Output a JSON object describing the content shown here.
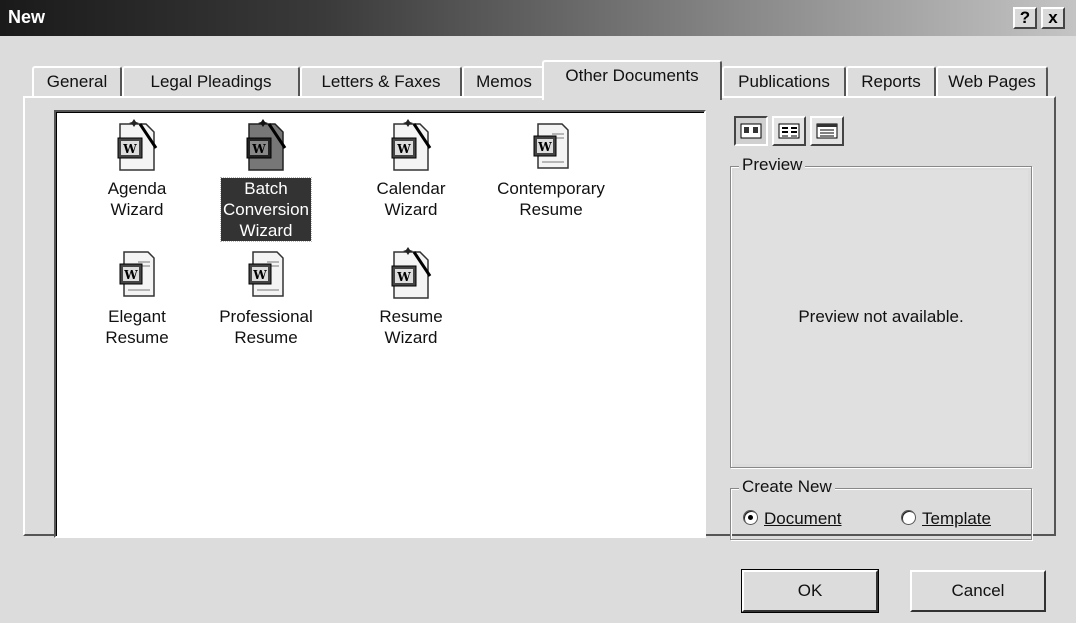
{
  "window": {
    "title": "New",
    "help_label": "?",
    "close_label": "x"
  },
  "tabs": [
    {
      "label": "General"
    },
    {
      "label": "Legal Pleadings"
    },
    {
      "label": "Letters & Faxes"
    },
    {
      "label": "Memos"
    },
    {
      "label": "Other Documents",
      "active": true
    },
    {
      "label": "Publications"
    },
    {
      "label": "Reports"
    },
    {
      "label": "Web Pages"
    }
  ],
  "items": [
    {
      "label": "Agenda\nWizard",
      "icon": "word-wizard-icon"
    },
    {
      "label": "Batch\nConversion\nWizard",
      "icon": "word-wizard-icon",
      "selected": true
    },
    {
      "label": "Calendar\nWizard",
      "icon": "word-wizard-icon"
    },
    {
      "label": "Contemporary\nResume",
      "icon": "word-document-icon"
    },
    {
      "label": "Elegant\nResume",
      "icon": "word-document-icon"
    },
    {
      "label": "Professional\nResume",
      "icon": "word-document-icon"
    },
    {
      "label": "Resume\nWizard",
      "icon": "word-wizard-icon"
    }
  ],
  "view_buttons": [
    "large-icons-view-icon",
    "list-view-icon",
    "details-view-icon"
  ],
  "preview": {
    "group_label": "Preview",
    "message": "Preview not available."
  },
  "create_new": {
    "group_label": "Create New",
    "options": [
      {
        "label": "Document",
        "checked": true
      },
      {
        "label": "Template",
        "checked": false
      }
    ]
  },
  "buttons": {
    "ok": "OK",
    "cancel": "Cancel"
  }
}
